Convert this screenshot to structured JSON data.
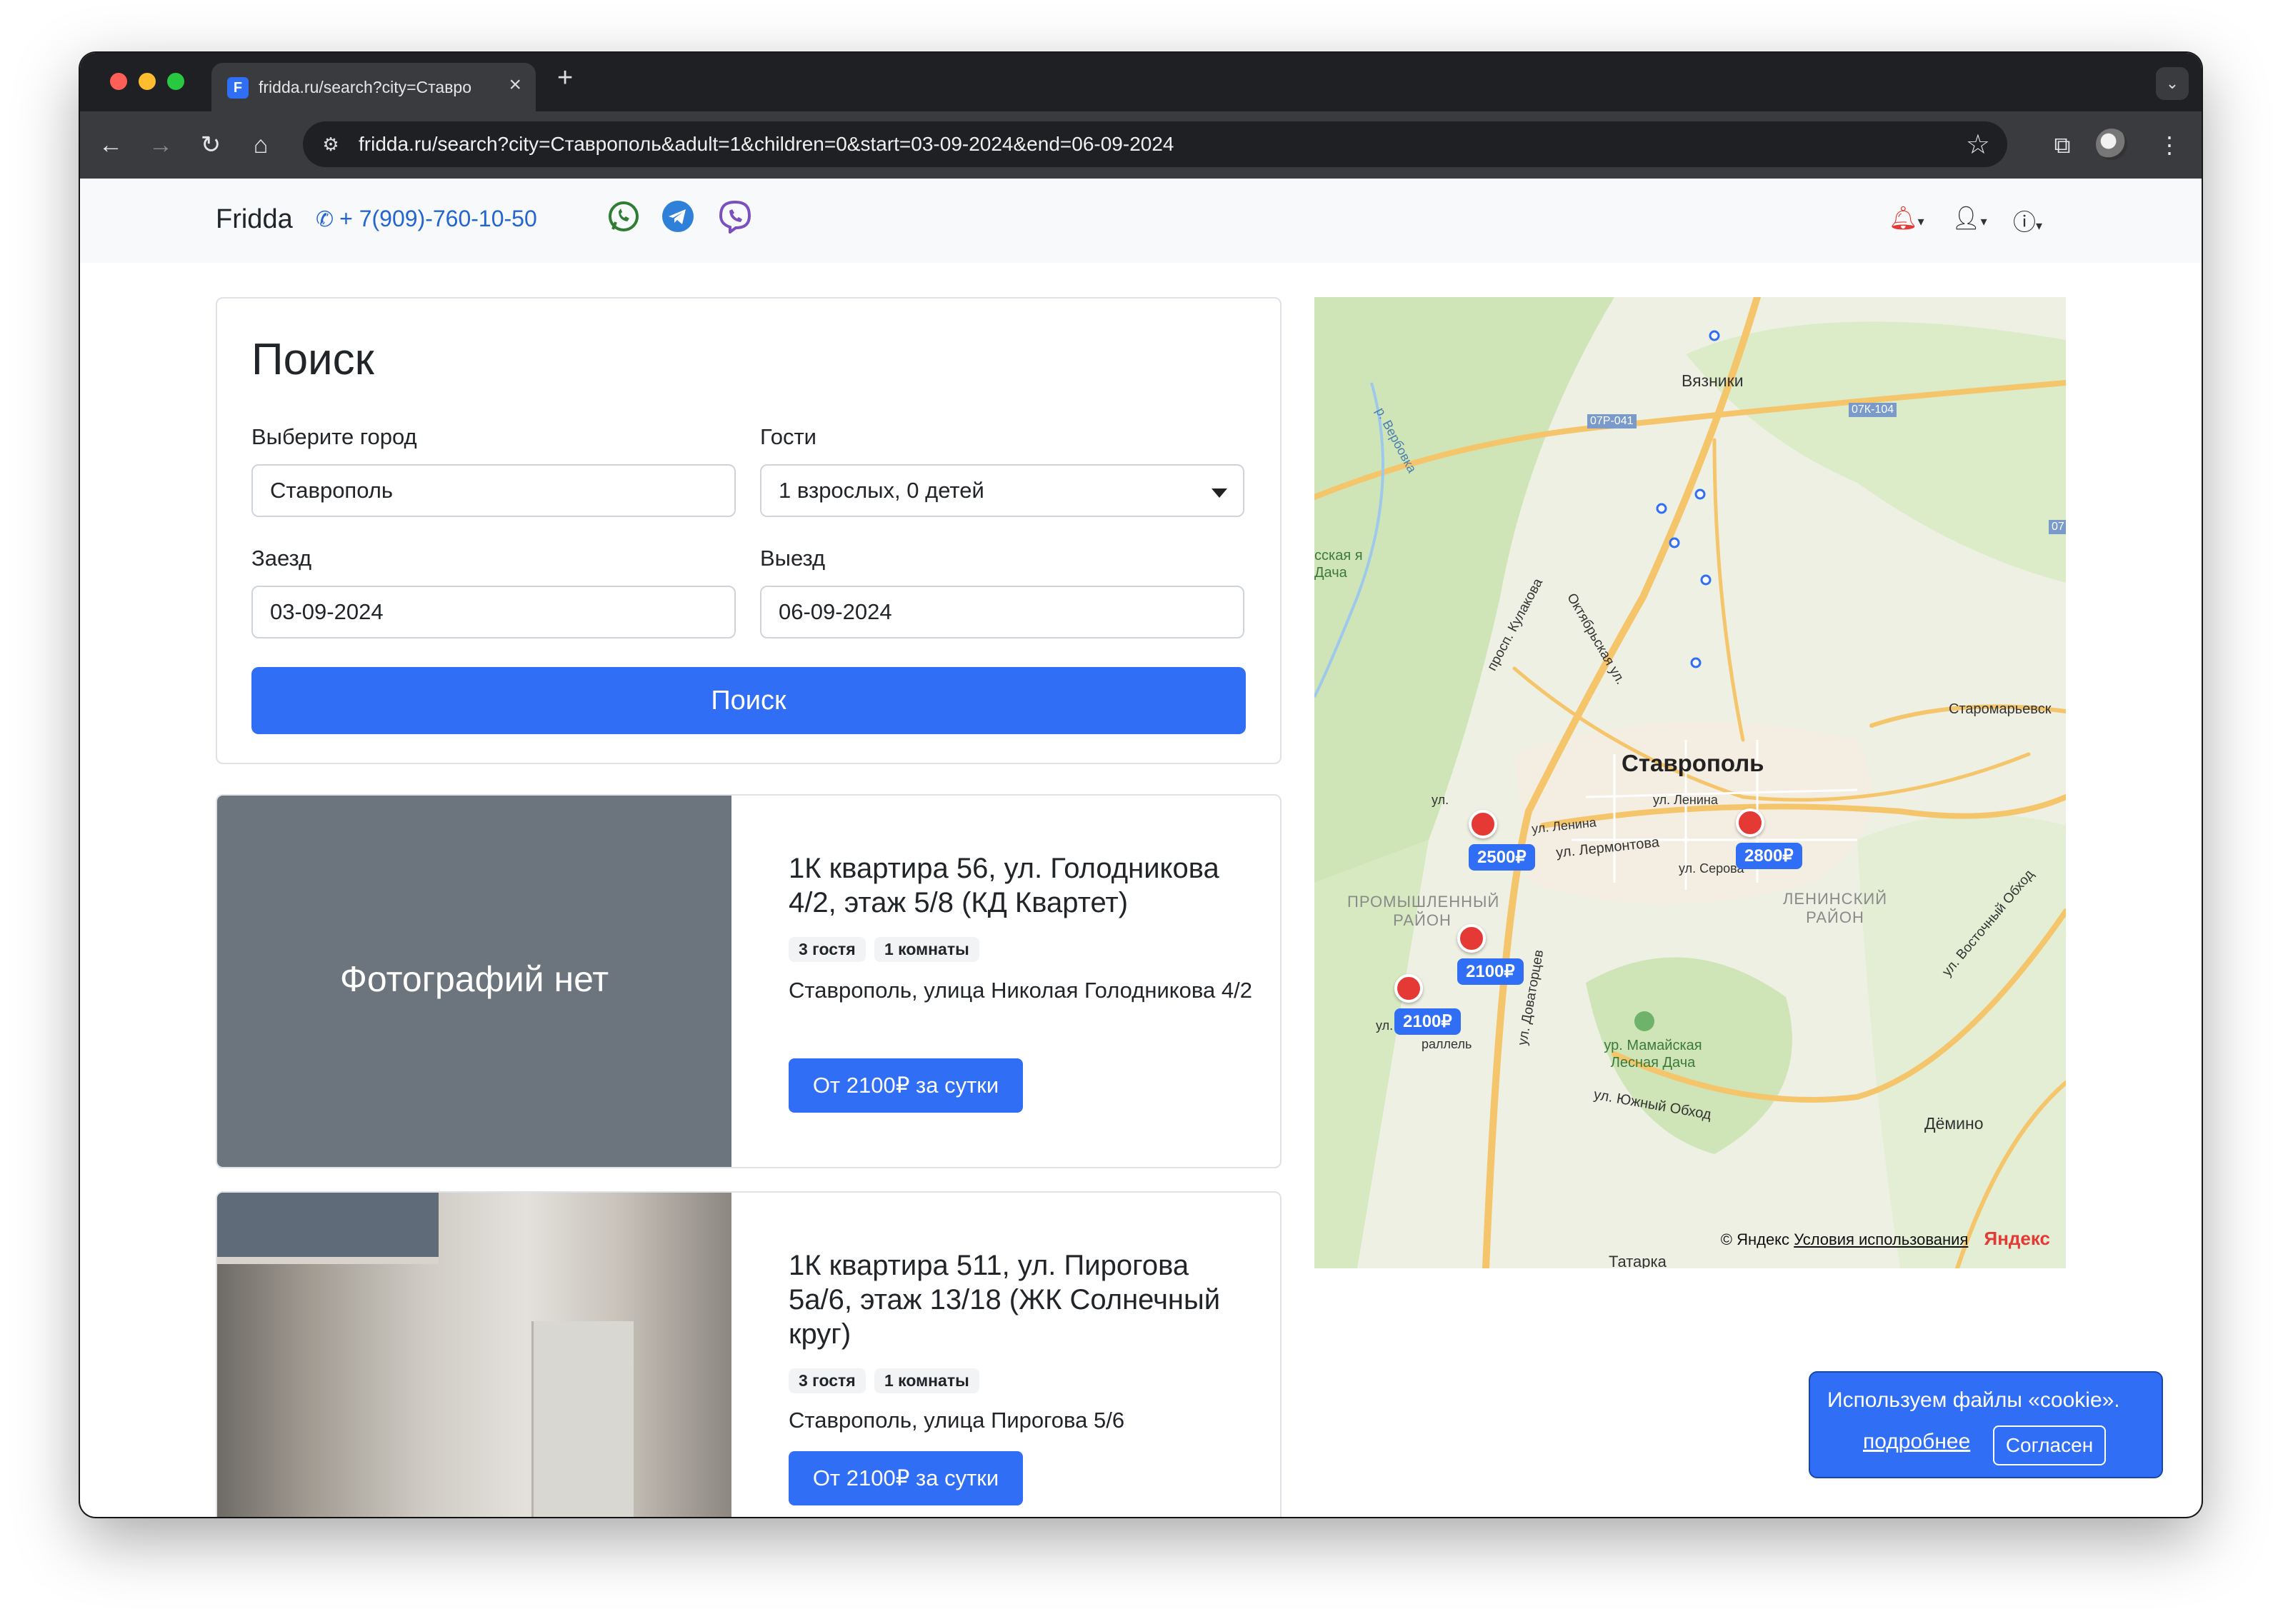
{
  "browser": {
    "tab_title": "fridda.ru/search?city=Ставро",
    "favicon_letter": "F",
    "url": "fridda.ru/search?city=Ставрополь&adult=1&children=0&start=03-09-2024&end=06-09-2024",
    "icons": {
      "back": "arrow-left-icon",
      "forward": "arrow-right-icon",
      "reload": "reload-icon",
      "home": "home-icon",
      "site_info": "tune-icon",
      "bookmark": "star-icon",
      "extensions": "puzzle-icon",
      "menu": "more-vert-icon"
    }
  },
  "header": {
    "brand": "Fridda",
    "phone": "+ 7(909)-760-10-50",
    "social": [
      "whatsapp-icon",
      "telegram-icon",
      "viber-icon"
    ],
    "right_icons": [
      "bell-icon",
      "user-icon",
      "help-icon"
    ]
  },
  "search": {
    "title": "Поиск",
    "city_label": "Выберите город",
    "city_value": "Ставрополь",
    "guests_label": "Гости",
    "guests_value": "1 взрослых, 0 детей",
    "checkin_label": "Заезд",
    "checkin_value": "03-09-2024",
    "checkout_label": "Выезд",
    "checkout_value": "06-09-2024",
    "button": "Поиск"
  },
  "listings": [
    {
      "no_photo": "Фотографий нет",
      "title": "1К квартира 56, ул. Голодникова 4/2, этаж 5/8 (КД Квартет)",
      "badges": [
        "3 гостя",
        "1 комнаты"
      ],
      "address": "Ставрополь, улица Николая Голодникова 4/2",
      "price": "От 2100₽ за сутки"
    },
    {
      "title": "1К квартира 511, ул. Пирогова 5а/6, этаж 13/18 (ЖК Солнечный круг)",
      "badges": [
        "3 гостя",
        "1 комнаты"
      ],
      "address": "Ставрополь, улица Пирогова 5/6",
      "price": "От 2100₽ за сутки"
    }
  ],
  "map": {
    "labels": {
      "city": "Ставрополь",
      "vyazniki": "Вязники",
      "dyomino": "Дёмино",
      "tatarka": "Татарка",
      "staromaryevsk": "Старомарьевск",
      "road1": "07Р-041",
      "road2": "07К-104",
      "road3": "07",
      "prom_district": "ПРОМЫШЛЕННЫЙ РАЙОН",
      "lenin_district": "ЛЕНИНСКИЙ РАЙОН",
      "mamai": "ур. Мамайская Лесная Дача",
      "russkaya": "сская я Дача",
      "river": "р. Вербовка",
      "pr_kulakova": "просп. Кулакова",
      "oktyabrskaya": "Октябрьская ул.",
      "lenina1": "ул. Ленина",
      "lenina2": "ул. Ленина",
      "lermontova": "ул. Лермонтова",
      "serova": "ул. Серова",
      "vostochny": "ул. Восточный Обход",
      "yuzhny": "ул. Южный Обход",
      "dovatortsev": "ул. Доваторцев",
      "ul_left1": "ул.",
      "ul_left2": "ул.",
      "parallel": "раллель"
    },
    "pins": [
      {
        "price": "2500₽"
      },
      {
        "price": "2800₽"
      },
      {
        "price": "2100₽"
      },
      {
        "price": "2100₽"
      }
    ],
    "copyright": "© Яндекс",
    "terms": "Условия использования",
    "brand": "Яндекс"
  },
  "cookie": {
    "text": "Используем файлы «cookie».",
    "link": "подробнее",
    "button": "Согласен"
  }
}
